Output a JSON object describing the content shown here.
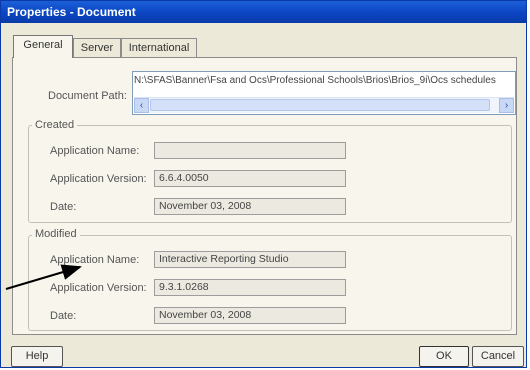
{
  "window": {
    "title": "Properties - Document"
  },
  "tabs": [
    "General",
    "Server",
    "International"
  ],
  "document_path": {
    "label": "Document Path:",
    "value": "N:\\SFAS\\Banner\\Fsa and Ocs\\Professional Schools\\Brios\\Brios_9i\\Ocs schedules"
  },
  "created": {
    "title": "Created",
    "app_name_label": "Application Name:",
    "app_name": "",
    "app_version_label": "Application Version:",
    "app_version": "6.6.4.0050",
    "date_label": "Date:",
    "date": "November 03, 2008"
  },
  "modified": {
    "title": "Modified",
    "app_name_label": "Application Name:",
    "app_name": "Interactive Reporting Studio",
    "app_version_label": "Application Version:",
    "app_version": "9.3.1.0268",
    "date_label": "Date:",
    "date": "November 03, 2008"
  },
  "buttons": {
    "help": "Help",
    "ok": "OK",
    "cancel": "Cancel"
  },
  "colors": {
    "titlebar": "#0c45c2",
    "window_bg": "#ece9d8",
    "arrow": "#000000"
  }
}
